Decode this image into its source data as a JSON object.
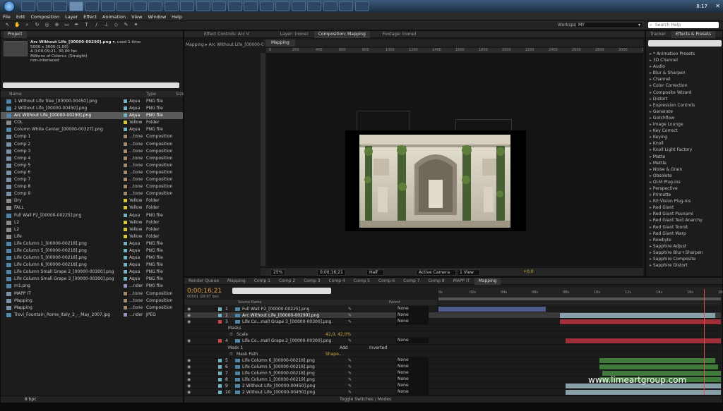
{
  "taskbar": {
    "clock": "8:17"
  },
  "menu": [
    "File",
    "Edit",
    "Composition",
    "Layer",
    "Effect",
    "Animation",
    "View",
    "Window",
    "Help"
  ],
  "workspace": {
    "label": "Workspace:",
    "value": "MY"
  },
  "search_help": {
    "placeholder": "Search Help"
  },
  "project": {
    "tab": "Project",
    "info": {
      "name": "Arc Without Life_[00000-00290].png ▾",
      "used": ", used 1 time",
      "dims": "5000 x 3600 (1,00)",
      "time": "Δ 0;00;09;21, 30,00 fps",
      "colors": "Millions of Colors+ (Straight)",
      "interlace": "non-interlaced"
    },
    "cols": {
      "name": "Name",
      "type": "Type",
      "size": "Size"
    },
    "items": [
      {
        "name": "1 Without Life Tree_[00000-00450].png",
        "label": "Aqua",
        "type": "PNG file",
        "color": "#6fb3c4",
        "kind": "img"
      },
      {
        "name": "2 Without Life_[00000-00450].png",
        "label": "Aqua",
        "type": "PNG file",
        "color": "#6fb3c4",
        "kind": "img"
      },
      {
        "name": "Arc Without Life_[00000-00290].png",
        "label": "Aqua",
        "type": "PNG file",
        "color": "#6fb3c4",
        "kind": "img",
        "selected": true
      },
      {
        "name": "COL",
        "label": "Yellow",
        "type": "Folder",
        "color": "#d6c43a",
        "kind": "folder"
      },
      {
        "name": "Column White Center_[00000-00327].png",
        "label": "Aqua",
        "type": "PNG file",
        "color": "#6fb3c4",
        "kind": "img"
      },
      {
        "name": "Comp 1",
        "label": "...tone",
        "type": "Composition",
        "color": "#a48a6a",
        "kind": "comp"
      },
      {
        "name": "Comp 2",
        "label": "...tone",
        "type": "Composition",
        "color": "#a48a6a",
        "kind": "comp"
      },
      {
        "name": "Comp 3",
        "label": "...tone",
        "type": "Composition",
        "color": "#a48a6a",
        "kind": "comp"
      },
      {
        "name": "Comp 4",
        "label": "...tone",
        "type": "Composition",
        "color": "#a48a6a",
        "kind": "comp"
      },
      {
        "name": "Comp 5",
        "label": "...tone",
        "type": "Composition",
        "color": "#a48a6a",
        "kind": "comp"
      },
      {
        "name": "Comp 6",
        "label": "...tone",
        "type": "Composition",
        "color": "#a48a6a",
        "kind": "comp"
      },
      {
        "name": "Comp 7",
        "label": "...tone",
        "type": "Composition",
        "color": "#a48a6a",
        "kind": "comp"
      },
      {
        "name": "Comp 8",
        "label": "...tone",
        "type": "Composition",
        "color": "#a48a6a",
        "kind": "comp"
      },
      {
        "name": "Comp 9",
        "label": "...tone",
        "type": "Composition",
        "color": "#a48a6a",
        "kind": "comp"
      },
      {
        "name": "Dry",
        "label": "Yellow",
        "type": "Folder",
        "color": "#d6c43a",
        "kind": "folder"
      },
      {
        "name": "FALL",
        "label": "Yellow",
        "type": "Folder",
        "color": "#d6c43a",
        "kind": "folder"
      },
      {
        "name": "Full Wall P2_[00000-00225].png",
        "label": "Aqua",
        "type": "PNG file",
        "color": "#6fb3c4",
        "kind": "img"
      },
      {
        "name": "L2",
        "label": "Yellow",
        "type": "Folder",
        "color": "#d6c43a",
        "kind": "folder"
      },
      {
        "name": "L2",
        "label": "Yellow",
        "type": "Folder",
        "color": "#d6c43a",
        "kind": "folder"
      },
      {
        "name": "Life",
        "label": "Yellow",
        "type": "Folder",
        "color": "#d6c43a",
        "kind": "folder"
      },
      {
        "name": "Life Column 1_[00000-00218].png",
        "label": "Aqua",
        "type": "PNG file",
        "color": "#6fb3c4",
        "kind": "img"
      },
      {
        "name": "Life Column 5_[00000-00218].png",
        "label": "Aqua",
        "type": "PNG file",
        "color": "#6fb3c4",
        "kind": "img"
      },
      {
        "name": "Life Column 5_[00000-00218].png",
        "label": "Aqua",
        "type": "PNG file",
        "color": "#6fb3c4",
        "kind": "img"
      },
      {
        "name": "Life Column 6_[00000-00218].png",
        "label": "Aqua",
        "type": "PNG file",
        "color": "#6fb3c4",
        "kind": "img"
      },
      {
        "name": "Life Column Small Grape 2_[00000-00300].png",
        "label": "Aqua",
        "type": "PNG file",
        "color": "#6fb3c4",
        "kind": "img"
      },
      {
        "name": "Life Column Small Grape 3_[00000-00300].png",
        "label": "Aqua",
        "type": "PNG file",
        "color": "#6fb3c4",
        "kind": "img"
      },
      {
        "name": "m1.png",
        "label": "...nder",
        "type": "PNG file",
        "color": "#9a8fc4",
        "kind": "img"
      },
      {
        "name": "MAPP IT",
        "label": "...tone",
        "type": "Composition",
        "color": "#a48a6a",
        "kind": "comp"
      },
      {
        "name": "Mapping",
        "label": "...tone",
        "type": "Composition",
        "color": "#a48a6a",
        "kind": "comp"
      },
      {
        "name": "Mapping",
        "label": "...tone",
        "type": "Composition",
        "color": "#a48a6a",
        "kind": "comp"
      },
      {
        "name": "Trevi_Fountain_Rome_Italy_2_-_May_2007.jpg",
        "label": "...nder",
        "type": "JPEG",
        "color": "#9a8fc4",
        "kind": "img"
      }
    ],
    "footer": "8 bpc"
  },
  "viewer": {
    "tabs": {
      "effect_controls": "Effect Controls: Arc V",
      "layer": "Layer: (none)",
      "composition": "Composition: Mapping",
      "footage": "Footage: (none)"
    },
    "breadcrumb": "Mapping ▸ Arc Without Life_[00000-00",
    "comp_label": "Mapping",
    "ruler": [
      "0",
      "200",
      "400",
      "600",
      "800",
      "1000",
      "1200",
      "1400",
      "1600",
      "1800",
      "2000",
      "2200",
      "2400",
      "2600",
      "2800",
      "3000",
      "3200"
    ],
    "bottom": {
      "zoom": "25%",
      "time": "0;00;16;21",
      "res": "Half",
      "camera": "Active Camera",
      "views": "1 View",
      "exposure": "+0,0"
    }
  },
  "effects": {
    "tab1": "Tracker",
    "tab2": "Effects & Presets",
    "items": [
      "* Animation Presets",
      "3D Channel",
      "Audio",
      "Blur & Sharpen",
      "Channel",
      "Color Correction",
      "Composite Wizard",
      "Distort",
      "Expression Controls",
      "Generate",
      "Gotchflow",
      "Image Lounge",
      "Key Correct",
      "Keying",
      "Knoll",
      "Knoll Light Factory",
      "Matte",
      "Mettle",
      "Noise & Grain",
      "Obsolete",
      "OLM Plug-ins",
      "Perspective",
      "Primatte",
      "RE:Vision Plug-ins",
      "Red Giant",
      "Red Giant Psunami",
      "Red Giant Text Anarchy",
      "Red Giant ToonIt",
      "Red Giant Warp",
      "Rowbyte",
      "Sapphire Adjust",
      "Sapphire Blur+Sharpen",
      "Sapphire Composite",
      "Sapphire Distort"
    ]
  },
  "timeline": {
    "tabs": [
      "Render Queue",
      "Mapping",
      "Comp 1",
      "Comp 2",
      "Comp 3",
      "Comp 4",
      "Comp 5",
      "Comp 6",
      "Comp 7",
      "Comp 8",
      "MAPP IT",
      "Mapping"
    ],
    "active_tab": 11,
    "timecode": "0;00;16;21",
    "fps": "00501 (29.97 fps)",
    "col_source": "Source Name",
    "col_parent": "Parent",
    "ticks": [
      "0s",
      "02s",
      "04s",
      "06s",
      "08s",
      "10s",
      "12s",
      "14s",
      "16s",
      "18s"
    ],
    "layers": [
      {
        "num": "1",
        "name": "Full Wall P2_[00000-00225].png",
        "parent": "None",
        "bar_start": 0.0,
        "bar_end": 0.38,
        "bar_color": "#4d5c8a",
        "label_color": "#6fb3c4"
      },
      {
        "num": "2",
        "name": "Arc Without Life_[00000-00290].png",
        "parent": "None",
        "bar_start": 0.43,
        "bar_end": 0.98,
        "bar_color": "#8aa0a8",
        "label_color": "#6fb3c4",
        "selected": true
      },
      {
        "num": "3",
        "name": "Life Co...mall Grape 3_[00000-00300].png",
        "parent": "None",
        "bar_start": 0.43,
        "bar_end": 1.0,
        "bar_color": "#a12f3a",
        "label_color": "#c44"
      },
      {
        "sub": "Masks"
      },
      {
        "sub2": "Scale",
        "value": "42,0, 42,0%"
      },
      {
        "num": "4",
        "name": "Life Co...mall Grape 2_[00000-00300].png",
        "parent": "None",
        "bar_start": 0.45,
        "bar_end": 1.0,
        "bar_color": "#a12f3a",
        "label_color": "#c44"
      },
      {
        "sub": "Mask 1",
        "add": "Add",
        "inverted": "Inverted"
      },
      {
        "sub2": "Mask Path",
        "value": "Shape..."
      },
      {
        "num": "5",
        "name": "Life Column 6_[00000-00218].png",
        "parent": "None",
        "bar_start": 0.57,
        "bar_end": 0.98,
        "bar_color": "#3f7a3a",
        "label_color": "#6fb3c4"
      },
      {
        "num": "6",
        "name": "Life Column 5_[00000-00218].png",
        "parent": "None",
        "bar_start": 0.57,
        "bar_end": 0.99,
        "bar_color": "#3f7a3a",
        "label_color": "#6fb3c4"
      },
      {
        "num": "7",
        "name": "Life Column 5_[00000-00218].png",
        "parent": "None",
        "bar_start": 0.58,
        "bar_end": 1.0,
        "bar_color": "#3f7a3a",
        "label_color": "#6fb3c4"
      },
      {
        "num": "8",
        "name": "Life Column 1_[00000-00219].png",
        "parent": "None",
        "bar_start": 0.57,
        "bar_end": 1.0,
        "bar_color": "#3f7a3a",
        "label_color": "#6fb3c4"
      },
      {
        "num": "9",
        "name": "2 Without Life_[00000-00450].png",
        "parent": "None",
        "bar_start": 0.45,
        "bar_end": 1.0,
        "bar_color": "#8aa0a8",
        "label_color": "#6fb3c4"
      },
      {
        "num": "10",
        "name": "2 Without Life_[00000-00450].png",
        "parent": "None",
        "bar_start": 0.45,
        "bar_end": 1.0,
        "bar_color": "#8aa0a8",
        "label_color": "#6fb3c4"
      },
      {
        "num": "11",
        "name": "1 Without Life Tree_[00000-00450].png",
        "parent": "None",
        "bar_start": 0.35,
        "bar_end": 1.0,
        "bar_color": "#b3a640",
        "label_color": "#6fb3c4"
      }
    ],
    "footer": "Toggle Switches / Modes",
    "playhead": 0.94
  },
  "watermark": "www.limeartgroup.com"
}
